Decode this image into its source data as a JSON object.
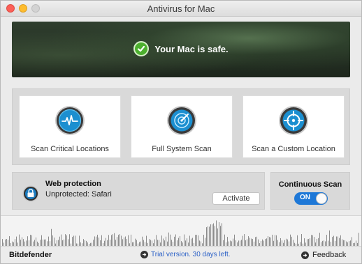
{
  "window": {
    "title": "Antivirus for Mac"
  },
  "status": {
    "message": "Your Mac is safe."
  },
  "scans": [
    {
      "label": "Scan Critical Locations",
      "icon": "heartbeat-icon"
    },
    {
      "label": "Full System Scan",
      "icon": "radar-icon"
    },
    {
      "label": "Scan a Custom Location",
      "icon": "target-icon"
    }
  ],
  "web_protection": {
    "title": "Web protection",
    "status": "Unprotected: Safari",
    "button": "Activate"
  },
  "continuous_scan": {
    "title": "Continuous Scan",
    "toggle": "ON"
  },
  "footer": {
    "brand": "Bitdefender",
    "trial": "Trial version. 30 days left.",
    "feedback": "Feedback"
  },
  "colors": {
    "accent": "#1e78d7",
    "safe": "#4caf2e",
    "link": "#2d62c7"
  }
}
